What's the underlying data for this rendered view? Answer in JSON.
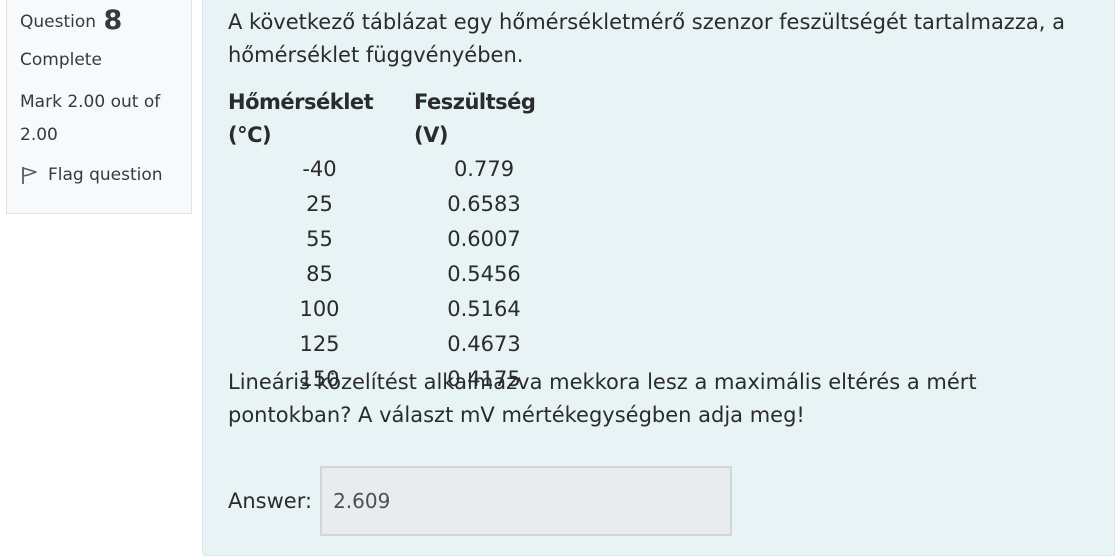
{
  "info": {
    "question_label": "Question",
    "question_number": "8",
    "state": "Complete",
    "grade": "Mark 2.00 out of 2.00",
    "flag_label": "Flag question",
    "flag_icon": "flag-icon"
  },
  "question": {
    "intro": "A következő táblázat egy hőmérsékletmérő szenzor feszültségét tartalmazza, a hőmérséklet függvényében.",
    "table": {
      "headers": [
        "Hőmérséklet (°C)",
        "Feszültség (V)"
      ],
      "rows": [
        [
          "-40",
          "0.779"
        ],
        [
          "25",
          "0.6583"
        ],
        [
          "55",
          "0.6007"
        ],
        [
          "85",
          "0.5456"
        ],
        [
          "100",
          "0.5164"
        ],
        [
          "125",
          "0.4673"
        ],
        [
          "150",
          "0.4175"
        ]
      ]
    },
    "prompt": "Lineáris közelítést alkalmazva mekkora lesz a maximális eltérés a mért pontokban? A választ mV mértékegységben adja meg!",
    "answer_label": "Answer:",
    "answer_value": "2.609"
  },
  "colors": {
    "content_bg": "#e7f3f5",
    "info_bg": "#f8f9fa",
    "input_bg": "#e9ecef"
  }
}
